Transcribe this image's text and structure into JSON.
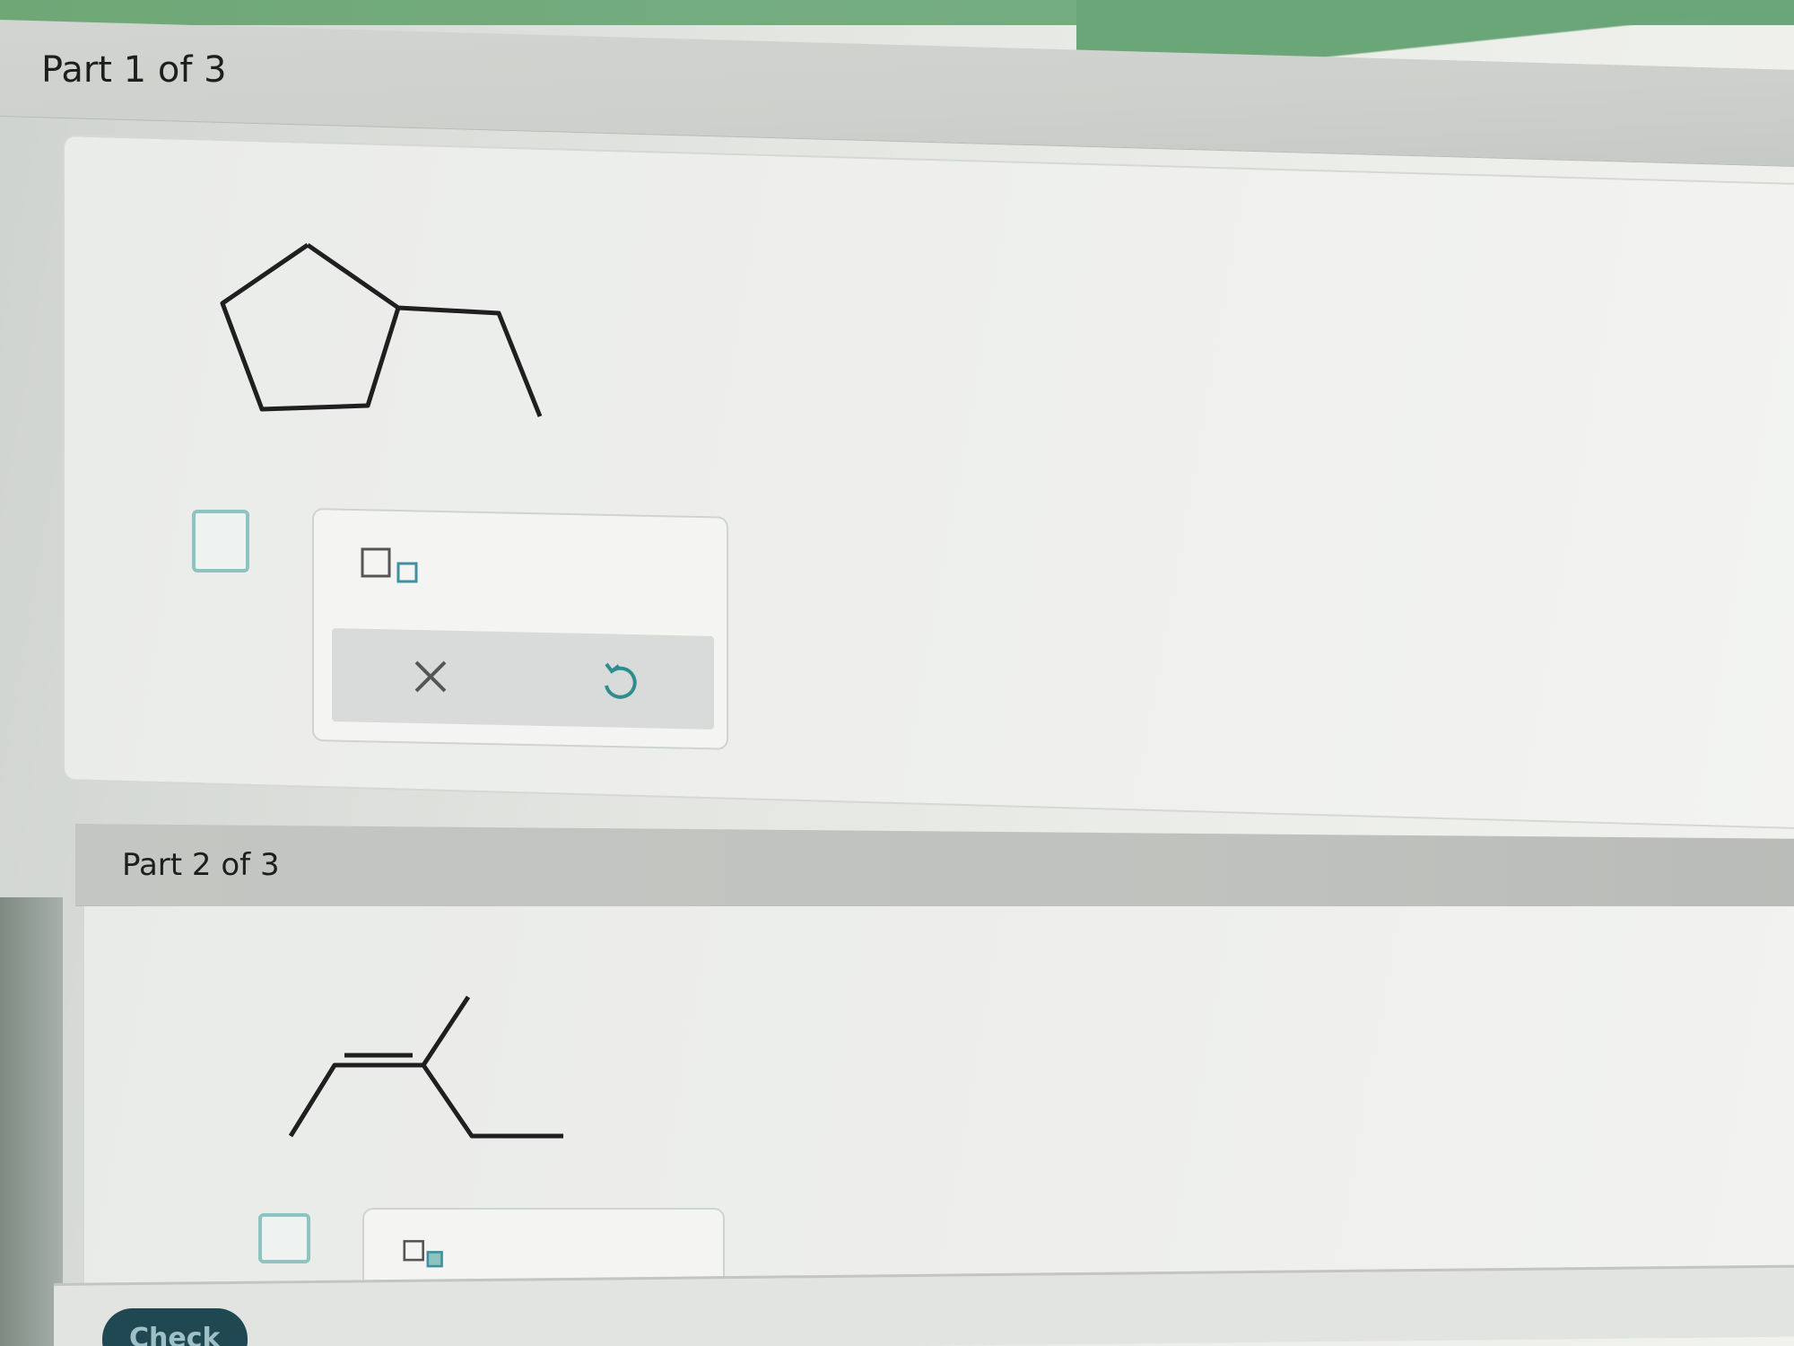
{
  "banner": {
    "title": ""
  },
  "parts": [
    {
      "header": "Part 1 of 3",
      "molecule": "ethylcyclopentane-skeletal"
    },
    {
      "header": "Part 2 of 3",
      "molecule": "alkene-skeletal"
    }
  ],
  "answer_toolbar": {
    "subscript_icon": "subscript-box-icon",
    "clear_icon": "x-icon",
    "undo_icon": "undo-icon"
  },
  "footer": {
    "check_label": "Check"
  },
  "colors": {
    "accent_teal": "#8fc3c0",
    "check_button_bg": "#1f4852",
    "banner_green": "#6fa777"
  }
}
